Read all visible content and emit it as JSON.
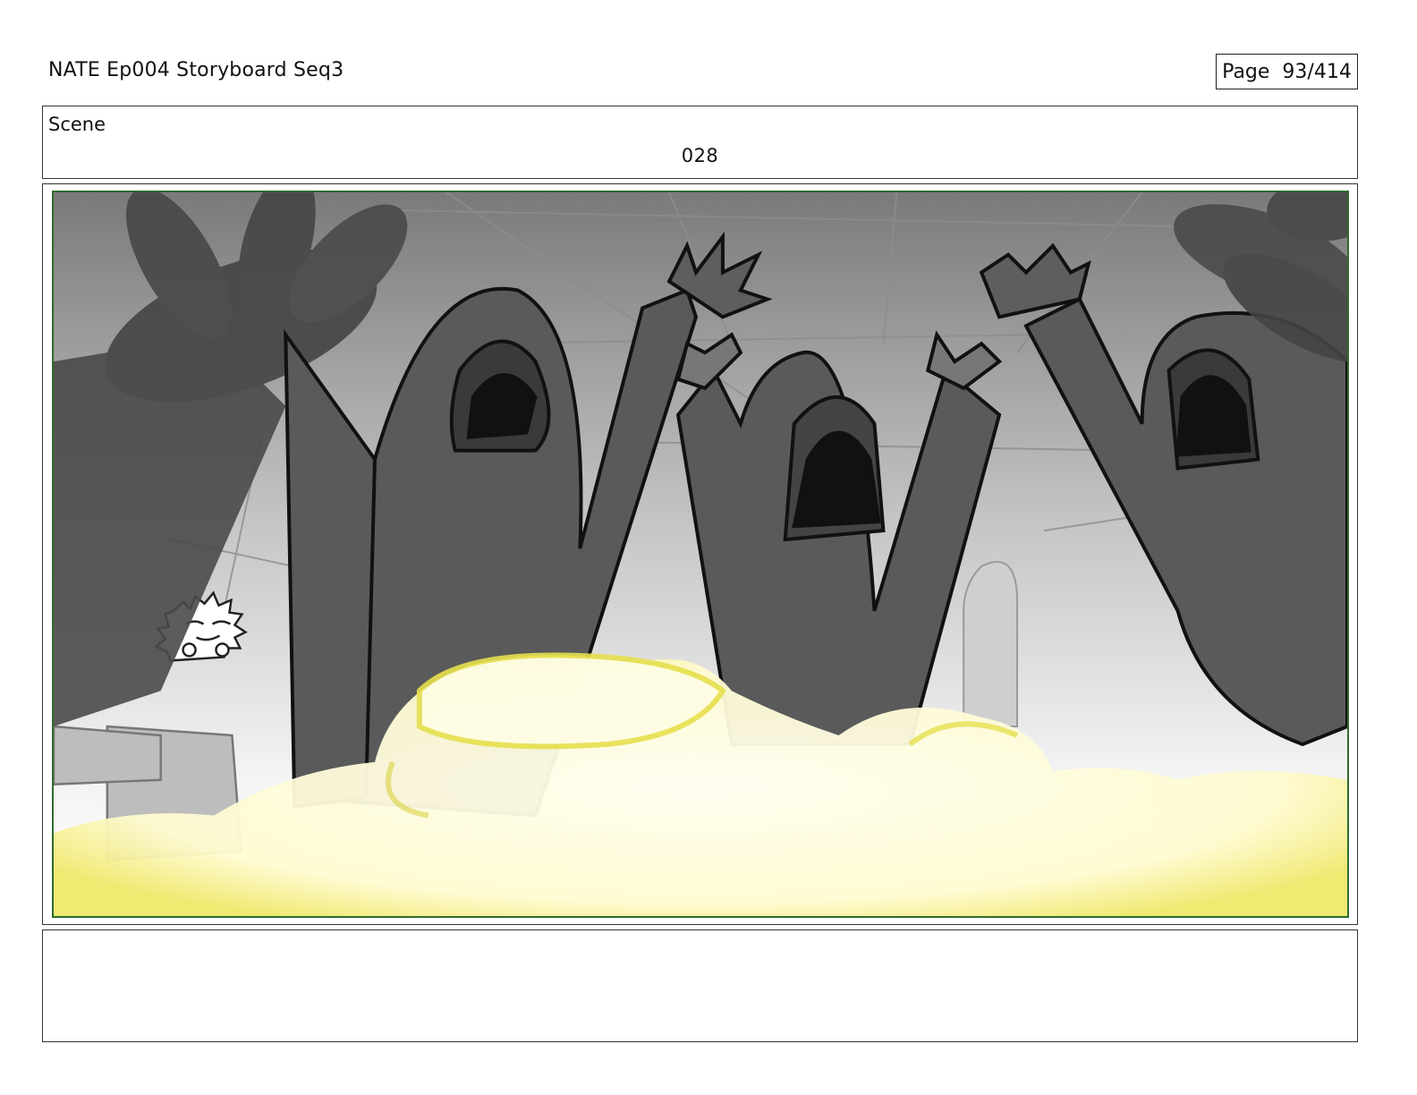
{
  "header": {
    "title": "NATE Ep004 Storyboard Seq3",
    "page_label": "Page  93/414"
  },
  "scene": {
    "label": "Scene",
    "number": "028"
  },
  "panel": {
    "description_colors": {
      "sky_top": "#7a7a7a",
      "sky_bottom": "#f2f2f2",
      "figure_fill": "#5a5a5a",
      "smoke": "#fffde8",
      "smoke_glow": "#f2f05a",
      "frame_border": "#2f6b2f"
    }
  },
  "notes": {
    "text": ""
  }
}
